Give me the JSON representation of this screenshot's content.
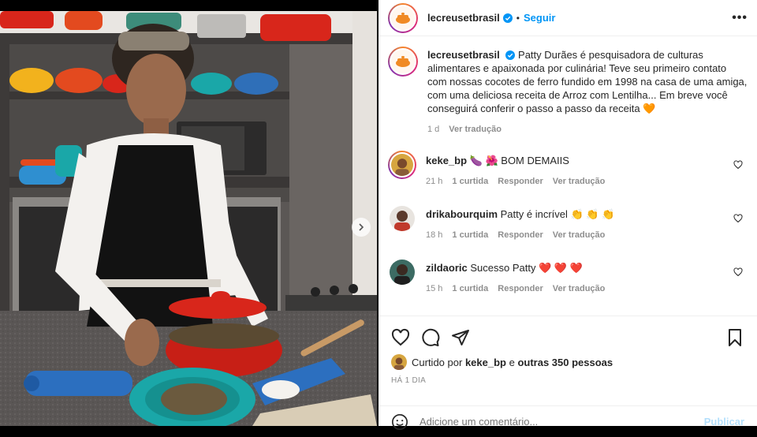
{
  "post": {
    "username": "lecreusetbrasil",
    "follow_label": "Seguir",
    "more_label": "•••",
    "separator": "•"
  },
  "caption": {
    "username": "lecreusetbrasil",
    "text": "Patty Durães é pesquisadora de culturas alimentares e apaixonada por culinária! Teve seu primeiro contato com nossas cocotes de ferro fundido em 1998 na casa de uma amiga, com uma deliciosa receita de Arroz com Lentilha... Em breve você conseguirá conferir o passo a passo da receita 🧡",
    "time": "1 d",
    "translate": "Ver tradução"
  },
  "comments": [
    {
      "user": "keke_bp",
      "text": "🍆 🌺 BOM DEMAIIS",
      "time": "21 h",
      "likes": "1 curtida",
      "reply": "Responder",
      "translate": "Ver tradução"
    },
    {
      "user": "drikabourquim",
      "text": "Patty é incrível 👏 👏 👏",
      "time": "18 h",
      "likes": "1 curtida",
      "reply": "Responder",
      "translate": "Ver tradução"
    },
    {
      "user": "zildaoric",
      "text": "Sucesso Patty ❤️ ❤️ ❤️",
      "time": "15 h",
      "likes": "1 curtida",
      "reply": "Responder",
      "translate": "Ver tradução"
    }
  ],
  "likes_line": {
    "prefix": "Curtido por",
    "user": "keke_bp",
    "middle": "e",
    "others": "outras 350 pessoas"
  },
  "date": "HÁ 1 DIA",
  "composer": {
    "placeholder": "Adicione um comentário...",
    "post_label": "Publicar"
  },
  "colors": {
    "accent": "#0095f6",
    "verified": "#0095f6",
    "muted": "#8e8e8e",
    "pot_red": "#d8261b",
    "teal": "#1aa7a8"
  },
  "icons": [
    "verified-badge-icon",
    "heart-icon",
    "comment-icon",
    "share-icon",
    "bookmark-icon",
    "emoji-icon",
    "chevron-right-icon",
    "more-icon"
  ]
}
